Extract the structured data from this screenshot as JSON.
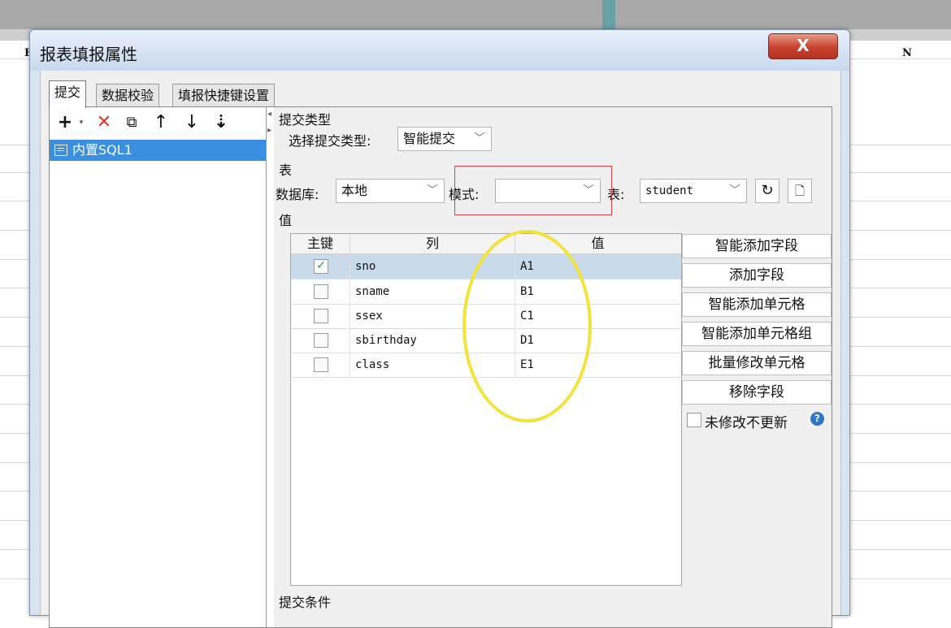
{
  "background": {
    "column_labels": [
      "F",
      "N"
    ]
  },
  "dialog": {
    "title": "报表填报属性",
    "close_label": "X",
    "tabs": [
      {
        "label": "提交"
      },
      {
        "label": "数据校验"
      },
      {
        "label": "填报快捷键设置"
      }
    ],
    "tree": {
      "items": [
        {
          "label": "内置SQL1"
        }
      ]
    },
    "submit_type": {
      "section": "提交类型",
      "label": "选择提交类型:",
      "value": "智能提交"
    },
    "table_section": {
      "section": "表",
      "database_label": "数据库:",
      "database_value": "本地",
      "mode_label": "模式:",
      "mode_value": "",
      "table_label": "表:",
      "table_value": "student"
    },
    "value_section": {
      "section": "值",
      "headers": [
        "主键",
        "列",
        "值"
      ],
      "rows": [
        {
          "key": true,
          "column": "sno",
          "value": "A1"
        },
        {
          "key": false,
          "column": "sname",
          "value": "B1"
        },
        {
          "key": false,
          "column": "ssex",
          "value": "C1"
        },
        {
          "key": false,
          "column": "sbirthday",
          "value": "D1"
        },
        {
          "key": false,
          "column": "class",
          "value": "E1"
        }
      ]
    },
    "buttons": {
      "smart_add_field": "智能添加字段",
      "add_field": "添加字段",
      "smart_add_cell": "智能添加单元格",
      "smart_add_cell_group": "智能添加单元格组",
      "batch_modify_cells": "批量修改单元格",
      "remove_field": "移除字段"
    },
    "no_update_label": "未修改不更新",
    "submit_condition_section": "提交条件"
  },
  "colors": {
    "selection": "#3b8fe0",
    "row_selected": "#c9dbea",
    "annotation_red": "#e04040",
    "annotation_yellow": "#f2e33a"
  }
}
